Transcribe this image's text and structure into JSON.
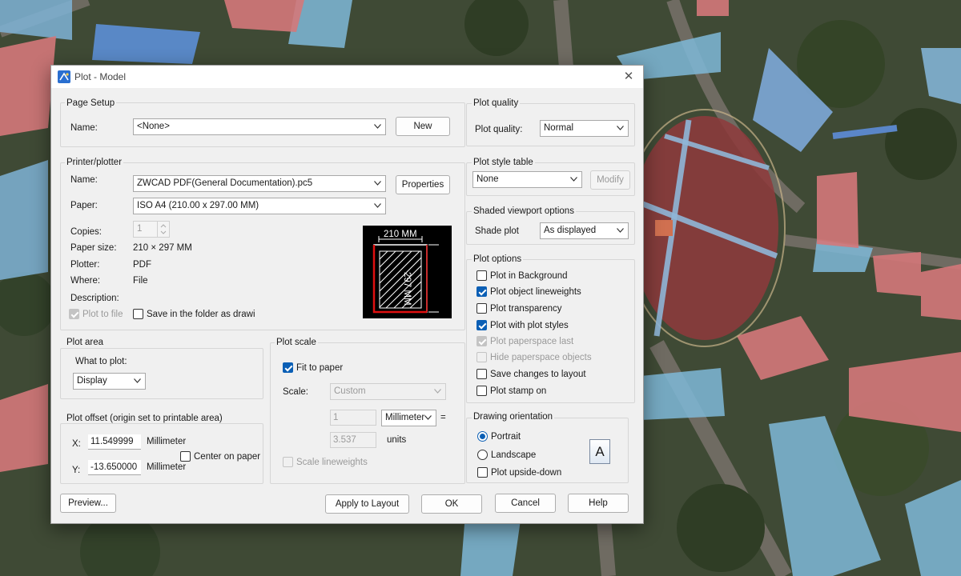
{
  "window": {
    "title": "Plot - Model"
  },
  "page_setup": {
    "group_label": "Page Setup",
    "name_label": "Name:",
    "name_value": "<None>",
    "new_button": "New"
  },
  "printer": {
    "group_label": "Printer/plotter",
    "name_label": "Name:",
    "name_value": "ZWCAD PDF(General Documentation).pc5",
    "properties_button": "Properties",
    "paper_label": "Paper:",
    "paper_value": "ISO A4 (210.00 x 297.00 MM)",
    "copies_label": "Copies:",
    "copies_value": "1",
    "paper_size_label": "Paper size:",
    "paper_size_value": "210 × 297  MM",
    "plotter_label": "Plotter:",
    "plotter_value": "PDF",
    "where_label": "Where:",
    "where_value": "File",
    "description_label": "Description:",
    "plot_to_file": "Plot to file",
    "save_in_folder": "Save in the folder as drawi",
    "preview_width_label": "210 MM",
    "preview_height_label": "297 MM"
  },
  "plot_area": {
    "group_label": "Plot area",
    "what_to_plot_label": "What to plot:",
    "what_to_plot_value": "Display"
  },
  "plot_offset": {
    "group_label": "Plot offset (origin set to printable area)",
    "x_label": "X:",
    "x_value": "11.549999",
    "x_unit": "Millimeter",
    "y_label": "Y:",
    "y_value": "-13.650000",
    "y_unit": "Millimeter",
    "center_on_paper": "Center on paper"
  },
  "plot_scale": {
    "group_label": "Plot scale",
    "fit_to_paper": "Fit to paper",
    "scale_label": "Scale:",
    "scale_value": "Custom",
    "value1": "1",
    "unit_value": "Millimeter",
    "equals": "=",
    "value2": "3.537",
    "units_label": "units",
    "scale_lineweights": "Scale lineweights"
  },
  "plot_quality": {
    "group_label": "Plot quality",
    "label": "Plot quality:",
    "value": "Normal"
  },
  "plot_style_table": {
    "group_label": "Plot style table",
    "value": "None",
    "modify_button": "Modify"
  },
  "shaded_viewport": {
    "group_label": "Shaded viewport options",
    "shade_plot_label": "Shade plot",
    "shade_plot_value": "As displayed"
  },
  "plot_options": {
    "group_label": "Plot options",
    "items": [
      {
        "label": "Plot in Background",
        "checked": false,
        "enabled": true
      },
      {
        "label": "Plot object lineweights",
        "checked": true,
        "enabled": true
      },
      {
        "label": "Plot transparency",
        "checked": false,
        "enabled": true
      },
      {
        "label": "Plot with plot styles",
        "checked": true,
        "enabled": true
      },
      {
        "label": "Plot paperspace last",
        "checked": true,
        "enabled": false
      },
      {
        "label": "Hide paperspace objects",
        "checked": false,
        "enabled": false
      },
      {
        "label": "Save changes to layout",
        "checked": false,
        "enabled": true
      },
      {
        "label": "Plot stamp on",
        "checked": false,
        "enabled": true
      }
    ]
  },
  "drawing_orientation": {
    "group_label": "Drawing orientation",
    "portrait": "Portrait",
    "landscape": "Landscape",
    "upside_down": "Plot upside-down",
    "selected": "portrait",
    "icon_letter": "A"
  },
  "footer": {
    "preview_button": "Preview...",
    "apply_button": "Apply to Layout",
    "ok_button": "OK",
    "cancel_button": "Cancel",
    "help_button": "Help"
  },
  "colors": {
    "accent": "#0b5fb5",
    "dialog_bg": "#f0f0f0",
    "preview_bg": "#000000",
    "preview_red": "#e01010"
  }
}
